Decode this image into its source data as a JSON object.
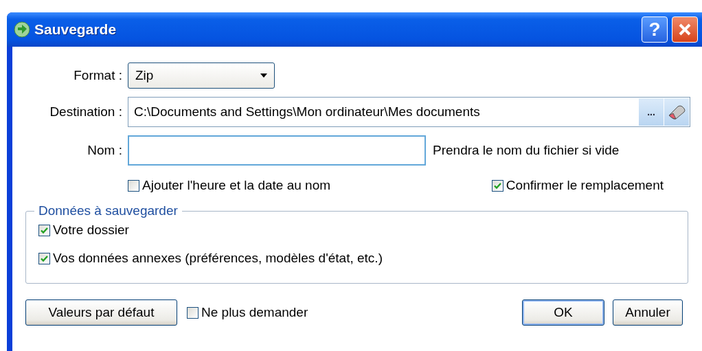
{
  "window": {
    "title": "Sauvegarde",
    "help_button": "?"
  },
  "format": {
    "label": "Format :",
    "value": "Zip"
  },
  "destination": {
    "label": "Destination :",
    "value": "C:\\Documents and Settings\\Mon ordinateur\\Mes documents",
    "browse_button": "..."
  },
  "name": {
    "label": "Nom :",
    "focused": true,
    "hint": "Prendra le nom du fichier si vide"
  },
  "options": [
    {
      "label": "Ajouter l'heure et la date au nom",
      "checked": false
    },
    {
      "label": "Confirmer le remplacement",
      "checked": true
    }
  ],
  "data_group": {
    "title": "Données à sauvegarder",
    "items": [
      {
        "label": "Votre dossier",
        "checked": true
      },
      {
        "label": "Vos données annexes (préférences, modèles d'état, etc.)",
        "checked": true
      }
    ]
  },
  "footer": {
    "defaults_button": "Valeurs par défaut",
    "dont_ask": {
      "label": "Ne plus demander",
      "checked": false
    },
    "ok_button": "OK",
    "cancel_button": "Annuler"
  }
}
